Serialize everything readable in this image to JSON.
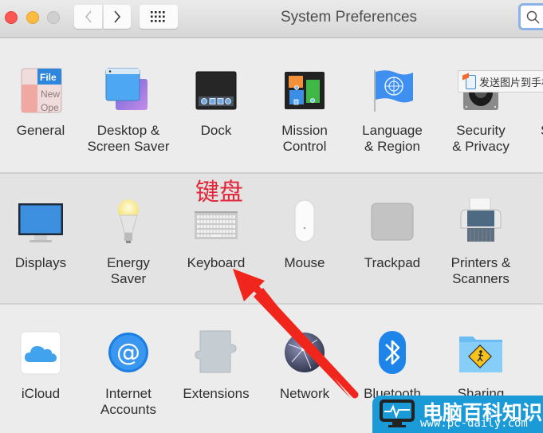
{
  "window": {
    "title": "System Preferences",
    "search_placeholder": ""
  },
  "toolbar": {
    "back_label": "‹",
    "forward_label": "›",
    "show_all_icon": "grid-icon",
    "search_icon": "search-icon"
  },
  "rows": [
    {
      "items": [
        {
          "label_1": "General",
          "label_2": "",
          "icon": "general-icon"
        },
        {
          "label_1": "Desktop &",
          "label_2": "Screen Saver",
          "icon": "desktop-screensaver-icon"
        },
        {
          "label_1": "Dock",
          "label_2": "",
          "icon": "dock-icon"
        },
        {
          "label_1": "Mission",
          "label_2": "Control",
          "icon": "mission-control-icon"
        },
        {
          "label_1": "Language",
          "label_2": "& Region",
          "icon": "language-region-icon"
        },
        {
          "label_1": "Security",
          "label_2": "& Privacy",
          "icon": "security-privacy-icon"
        },
        {
          "label_1": "S",
          "label_2": "",
          "icon": "spotlight-icon"
        }
      ]
    },
    {
      "items": [
        {
          "label_1": "Displays",
          "label_2": "",
          "icon": "displays-icon"
        },
        {
          "label_1": "Energy",
          "label_2": "Saver",
          "icon": "energy-saver-icon"
        },
        {
          "label_1": "Keyboard",
          "label_2": "",
          "icon": "keyboard-icon"
        },
        {
          "label_1": "Mouse",
          "label_2": "",
          "icon": "mouse-icon"
        },
        {
          "label_1": "Trackpad",
          "label_2": "",
          "icon": "trackpad-icon"
        },
        {
          "label_1": "Printers &",
          "label_2": "Scanners",
          "icon": "printer-icon"
        }
      ]
    },
    {
      "items": [
        {
          "label_1": "iCloud",
          "label_2": "",
          "icon": "icloud-icon"
        },
        {
          "label_1": "Internet",
          "label_2": "Accounts",
          "icon": "internet-accounts-icon"
        },
        {
          "label_1": "Extensions",
          "label_2": "",
          "icon": "extensions-icon"
        },
        {
          "label_1": "Network",
          "label_2": "",
          "icon": "network-icon"
        },
        {
          "label_1": "Bluetooth",
          "label_2": "",
          "icon": "bluetooth-icon"
        },
        {
          "label_1": "Sharing",
          "label_2": "",
          "icon": "sharing-icon"
        }
      ]
    }
  ],
  "general_icon_text": {
    "file": "File",
    "new": "New",
    "open": "Ope"
  },
  "annotation": {
    "text": "键盘",
    "color": "#e0283a"
  },
  "tooltip": {
    "text": "发送图片到手机"
  },
  "watermark": {
    "title": "电脑百科知识",
    "url": "www.pc-daily.com",
    "color": "#1a9ad7"
  },
  "colors": {
    "accent_blue": "#1a9ad7",
    "arrow_red": "#f0261c",
    "search_focus": "#8db3e6"
  }
}
